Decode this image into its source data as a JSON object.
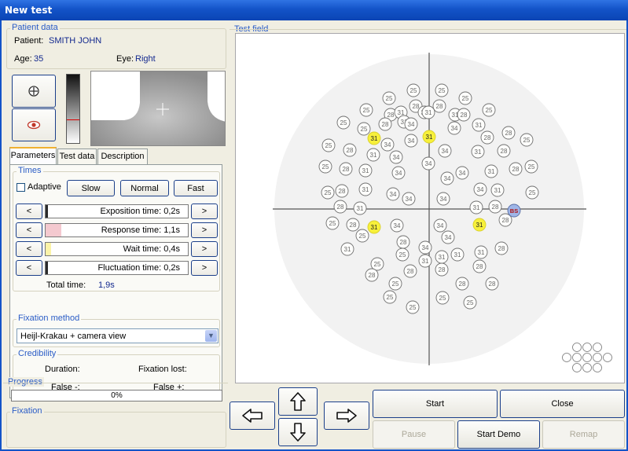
{
  "window": {
    "title": "New test"
  },
  "patient": {
    "group_title": "Patient data",
    "patient_label": "Patient:",
    "patient_name": "SMITH JOHN",
    "age_label": "Age:",
    "age": "35",
    "eye_label": "Eye:",
    "eye": "Right"
  },
  "tabs": [
    "Parameters",
    "Test data",
    "Description"
  ],
  "times": {
    "group_title": "Times",
    "adaptive_label": "Adaptive",
    "adaptive_checked": false,
    "speed_buttons": [
      "Slow",
      "Normal",
      "Fast"
    ],
    "rows": [
      {
        "label": "Exposition time:",
        "value": "0,2s",
        "color": "#2b2b2b"
      },
      {
        "label": "Response time:",
        "value": "1,1s",
        "color": "#f4c9cf"
      },
      {
        "label": "Wait time:",
        "value": "0,4s",
        "color": "#fbf3a8"
      },
      {
        "label": "Fluctuation time:",
        "value": "0,2s",
        "color": "#2b2b2b"
      }
    ],
    "dec_label": "<",
    "inc_label": ">",
    "total_label": "Total time:",
    "total_value": "1,9s"
  },
  "fixation_method": {
    "group_title": "Fixation method",
    "selected": "Heijl-Krakau + camera view"
  },
  "credibility": {
    "group_title": "Credibility",
    "duration_label": "Duration:",
    "fixation_lost_label": "Fixation lost:",
    "false_neg_label": "False -:",
    "false_pos_label": "False +:"
  },
  "progress": {
    "group_title": "Progress",
    "text": "0%",
    "fraction": 0
  },
  "fixation": {
    "group_title": "Fixation"
  },
  "test_field": {
    "group_title": "Test field",
    "blind_spot_label": "BS",
    "highlight_color": "#f7f03a",
    "stimuli": [
      {
        "v": "25"
      },
      {
        "v": "25"
      },
      {
        "v": "25"
      },
      {
        "v": "25"
      },
      {
        "v": "28"
      },
      {
        "v": "28"
      },
      {
        "v": "25"
      },
      {
        "v": "25"
      },
      {
        "v": "28"
      },
      {
        "v": "31"
      },
      {
        "v": "31"
      },
      {
        "v": "31"
      },
      {
        "v": "31"
      },
      {
        "v": "28"
      },
      {
        "v": "25"
      },
      {
        "v": "25"
      },
      {
        "v": "28"
      },
      {
        "v": "31"
      },
      {
        "v": "34"
      },
      {
        "v": "34"
      },
      {
        "v": "31"
      },
      {
        "v": "28"
      },
      {
        "v": "25"
      },
      {
        "v": "31",
        "hl": true
      },
      {
        "v": "34"
      },
      {
        "v": "34"
      },
      {
        "v": "31",
        "hl": true
      },
      {
        "v": "28"
      },
      {
        "v": "25"
      },
      {
        "v": "28"
      },
      {
        "v": "31"
      },
      {
        "v": "34"
      },
      {
        "v": "34"
      },
      {
        "v": "31"
      },
      {
        "v": "28"
      },
      {
        "v": "25"
      },
      {
        "v": "28"
      },
      {
        "v": "31"
      },
      {
        "v": "34"
      },
      {
        "v": "34"
      },
      {
        "v": "31"
      },
      {
        "v": "28"
      },
      {
        "v": "25"
      },
      {
        "v": "34"
      },
      {
        "v": "34"
      },
      {
        "v": "25"
      },
      {
        "v": "28"
      },
      {
        "v": "31"
      },
      {
        "v": "34"
      },
      {
        "v": "34"
      },
      {
        "v": "31"
      },
      {
        "v": "25"
      },
      {
        "v": "28"
      },
      {
        "v": "31"
      },
      {
        "v": "34"
      },
      {
        "v": "34"
      },
      {
        "v": "31"
      },
      {
        "v": "28"
      },
      {
        "v": "25"
      },
      {
        "v": "28"
      },
      {
        "v": "31",
        "hl": true
      },
      {
        "v": "34"
      },
      {
        "v": "34"
      },
      {
        "v": "31",
        "hl": true
      },
      {
        "v": "28"
      },
      {
        "v": "25"
      },
      {
        "v": "28"
      },
      {
        "v": "34"
      },
      {
        "v": "34"
      },
      {
        "v": "31"
      },
      {
        "v": "25"
      },
      {
        "v": "31"
      },
      {
        "v": "31"
      },
      {
        "v": "31"
      },
      {
        "v": "31"
      },
      {
        "v": "28"
      },
      {
        "v": "25"
      },
      {
        "v": "28"
      },
      {
        "v": "28"
      },
      {
        "v": "28"
      },
      {
        "v": "28"
      },
      {
        "v": "25"
      },
      {
        "v": "28"
      },
      {
        "v": "28"
      },
      {
        "v": "25"
      },
      {
        "v": "25"
      },
      {
        "v": "25"
      },
      {
        "v": "25"
      },
      {
        "v": "25"
      }
    ]
  },
  "controls": {
    "start": "Start",
    "close": "Close",
    "pause": "Pause",
    "start_demo": "Start Demo",
    "remap": "Remap"
  }
}
